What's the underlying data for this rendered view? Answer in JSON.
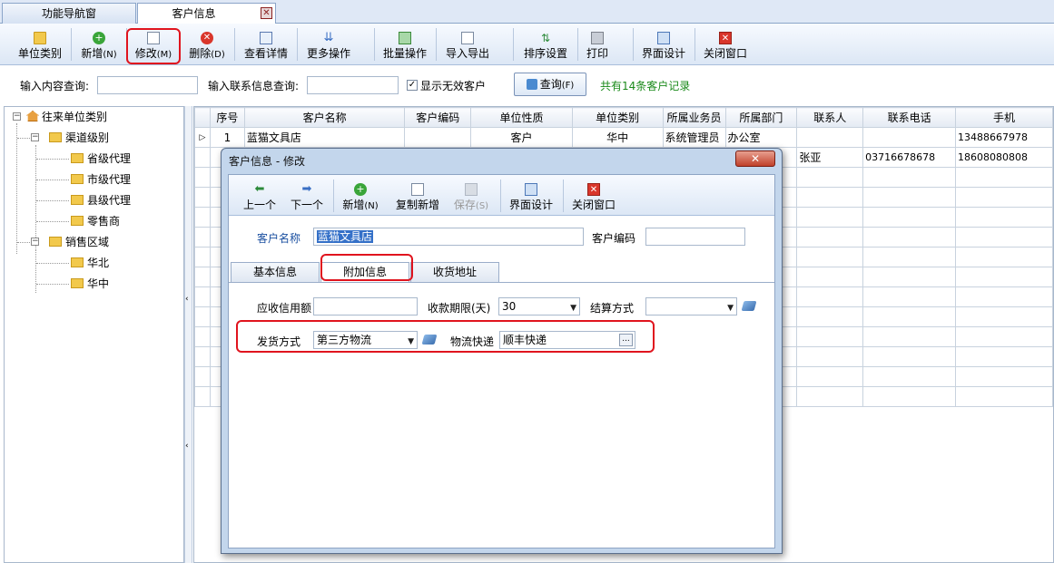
{
  "tabs": [
    {
      "label": "功能导航窗",
      "active": false
    },
    {
      "label": "客户信息",
      "active": true
    }
  ],
  "toolbar": {
    "unit_category": "单位类别",
    "add": "新增",
    "add_key": "(N)",
    "edit": "修改",
    "edit_key": "(M)",
    "delete": "删除",
    "delete_key": "(D)",
    "view_detail": "查看详情",
    "more_ops": "更多操作",
    "batch_ops": "批量操作",
    "import_export": "导入导出",
    "sort_settings": "排序设置",
    "print": "打印",
    "ui_design": "界面设计",
    "close_window": "关闭窗口"
  },
  "search": {
    "content_label": "输入内容查询:",
    "content_value": "",
    "contact_label": "输入联系信息查询:",
    "contact_value": "",
    "show_invalid_label": "显示无效客户",
    "show_invalid_checked": true,
    "query_button": "查询",
    "query_key": "(F)",
    "record_count": "共有14条客户记录",
    "record_count_color": "#1a8a1a"
  },
  "tree": {
    "root": "往来单位类别",
    "groups": [
      {
        "label": "渠道级别",
        "children": [
          "省级代理",
          "市级代理",
          "县级代理",
          "零售商"
        ]
      },
      {
        "label": "销售区域",
        "children": [
          "华北",
          "华中"
        ]
      }
    ]
  },
  "grid": {
    "columns": [
      "",
      "序号",
      "客户名称",
      "客户编码",
      "单位性质",
      "单位类别",
      "所属业务员",
      "所属部门",
      "联系人",
      "联系电话",
      "手机"
    ],
    "rows": [
      [
        "▷",
        "1",
        "蓝猫文具店",
        "",
        "客户",
        "华中",
        "系统管理员",
        "办公室",
        "",
        "",
        "13488667978"
      ],
      [
        "",
        "",
        "",
        "",
        "",
        "",
        "",
        "",
        "张亚",
        "03716678678",
        "18608080808"
      ]
    ]
  },
  "dialog": {
    "title": "客户信息 - 修改",
    "close": "✕",
    "toolbar": {
      "prev": "上一个",
      "next": "下一个",
      "add": "新增",
      "add_key": "(N)",
      "copy_add": "复制新增",
      "save": "保存",
      "save_key": "(S)",
      "ui_design": "界面设计",
      "close_window": "关闭窗口"
    },
    "customer_name_label": "客户名称",
    "customer_name_value": "蓝猫文具店",
    "customer_code_label": "客户编码",
    "customer_code_value": "",
    "tabs": [
      "基本信息",
      "附加信息",
      "收货地址"
    ],
    "active_tab": "附加信息",
    "credit_label": "应收信用额",
    "credit_value": "",
    "payment_term_label": "收款期限(天)",
    "payment_term_value": "30",
    "settlement_label": "结算方式",
    "settlement_value": "",
    "shipping_label": "发货方式",
    "shipping_value": "第三方物流",
    "courier_label": "物流快递",
    "courier_value": "顺丰快递",
    "ellipsis": "..."
  },
  "colors": {
    "highlight": "#e0141e",
    "title_text": "#1a4fa0"
  }
}
